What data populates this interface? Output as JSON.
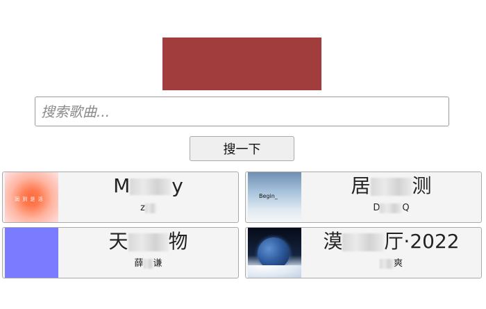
{
  "search": {
    "placeholder": "搜索歌曲...",
    "value": "",
    "button_label": "搜一下"
  },
  "banner": {
    "color": "#a23d3d"
  },
  "results": [
    {
      "title_start": "M",
      "title_end": "y",
      "artist_start": "z",
      "artist_end": "",
      "cover": "peach-gradient-cover",
      "cover_caption": "润 到 是 活"
    },
    {
      "title_start": "居",
      "title_end": "测",
      "artist_start": "D",
      "artist_end": "Q",
      "cover": "sky-cloud-cover",
      "cover_caption": "Begin_"
    },
    {
      "title_start": "天",
      "title_end": "物",
      "artist_start": "薛",
      "artist_end": "谦",
      "cover": "blue-square-cover",
      "cover_caption": ""
    },
    {
      "title_start": "漠",
      "title_end": "厅·2022",
      "artist_start": "",
      "artist_end": "爽",
      "cover": "planet-snow-cover",
      "cover_caption": ""
    }
  ]
}
